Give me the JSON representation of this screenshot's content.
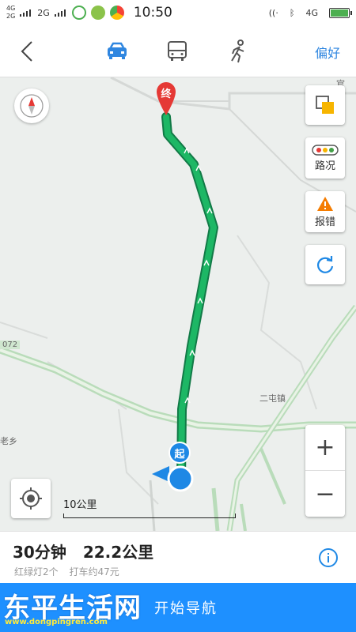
{
  "status_bar": {
    "sim1": "4G",
    "sim2": "2G",
    "sim3": "2G",
    "time": "10:50",
    "net_right": "4G"
  },
  "nav": {
    "modes": [
      "car-icon",
      "bus-icon",
      "walk-icon"
    ],
    "active_mode": "car",
    "preference_label": "偏好"
  },
  "map": {
    "end_marker": "终",
    "start_marker": "起",
    "road_label": "072",
    "town_label": "二屯镇",
    "town_label_left": "老乡",
    "town_top": "官",
    "compass_label": "N",
    "side_buttons": [
      {
        "icon": "layers-icon",
        "label": ""
      },
      {
        "icon": "traffic-light-icon",
        "label": "路况"
      },
      {
        "icon": "warning-icon",
        "label": "报错"
      },
      {
        "icon": "refresh-icon",
        "label": ""
      }
    ],
    "zoom_in": "+",
    "zoom_out": "−",
    "scale_label": "10公里"
  },
  "route": {
    "duration": "30分钟",
    "distance": "22.2公里",
    "traffic_lights": "红绿灯2个",
    "taxi_fare": "打车约47元"
  },
  "footer": {
    "start_navigation": "开始导航",
    "watermark": "东平生活网",
    "watermark_url": "www.dongpingren.com"
  },
  "colors": {
    "accent": "#2f86e0",
    "route": "#1db765",
    "footer_bg": "#1e90ff",
    "end_marker": "#e53935"
  }
}
